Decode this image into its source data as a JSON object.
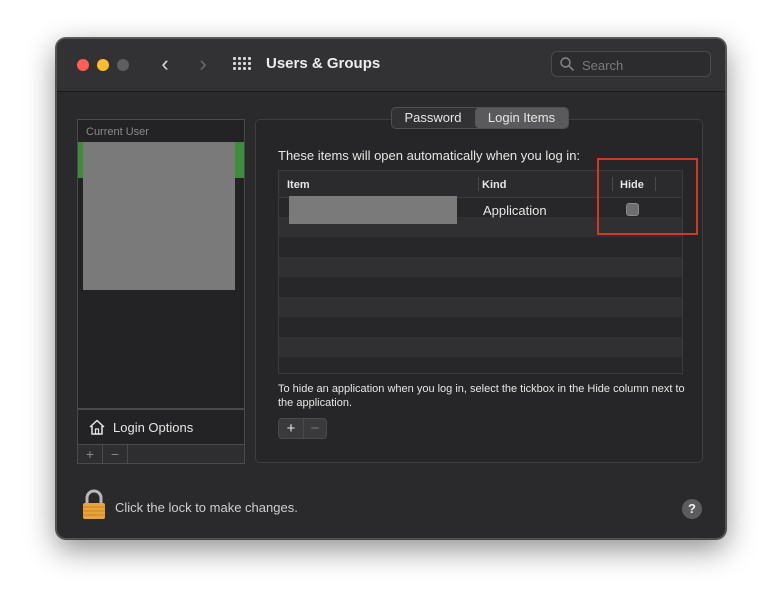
{
  "window": {
    "title": "Users & Groups"
  },
  "search": {
    "placeholder": "Search"
  },
  "sidebar": {
    "section_label": "Current User",
    "login_options_label": "Login Options",
    "add_label": "+",
    "remove_label": "−"
  },
  "tabs": [
    {
      "label": "Password",
      "selected": false
    },
    {
      "label": "Login Items",
      "selected": true
    }
  ],
  "login_items": {
    "description": "These items will open automatically when you log in:",
    "columns": [
      "Item",
      "Kind",
      "Hide"
    ],
    "rows": [
      {
        "item": "",
        "kind": "Application",
        "hide": false
      }
    ],
    "hint": "To hide an application when you log in, select the tickbox in the Hide column next to the application.",
    "add_label": "+",
    "remove_label": "−"
  },
  "footer": {
    "lock_text": "Click the lock to make changes.",
    "help_label": "?"
  },
  "colors": {
    "selection": "#3f8d3a",
    "highlight": "#d13a1f"
  }
}
